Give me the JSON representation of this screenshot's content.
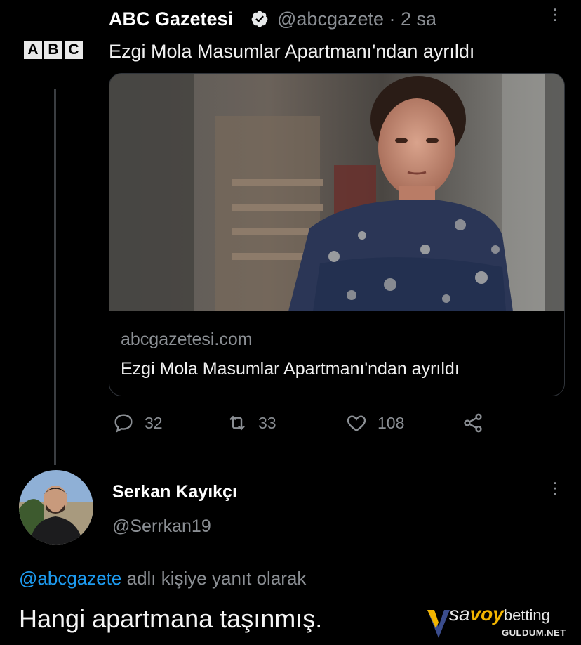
{
  "tweet": {
    "author_name": "ABC Gazetesi",
    "author_handle": "@abcgazete · 2 sa",
    "logo_letters": [
      "A",
      "B",
      "C"
    ],
    "text": "Ezgi Mola Masumlar Apartmanı'ndan ayrıldı",
    "card": {
      "domain": "abcgazetesi.com",
      "title": "Ezgi Mola Masumlar Apartmanı'ndan ayrıldı"
    },
    "actions": {
      "replies": "32",
      "retweets": "33",
      "likes": "108"
    },
    "icons": {
      "verified": "verified-badge-icon",
      "more": "more-vertical-icon",
      "reply": "reply-icon",
      "retweet": "retweet-icon",
      "like": "heart-icon",
      "share": "share-icon"
    }
  },
  "reply": {
    "author_name": "Serkan Kayıkçı",
    "author_handle": "@Serrkan19",
    "replying_prefix": "@abcgazete",
    "replying_suffix": " adlı kişiye yanıt olarak",
    "text": "Hangi apartmana taşınmış."
  },
  "watermark": {
    "brand_prefix": "sa",
    "brand_highlight": "voy",
    "brand_suffix": "betting",
    "site": "GULDUM.NET"
  },
  "colors": {
    "background": "#000000",
    "mention": "#1d9bf0",
    "muted": "#8b8f94",
    "brand": "#f2b500"
  }
}
